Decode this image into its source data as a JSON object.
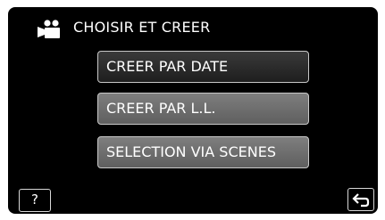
{
  "header": {
    "icon": "video-camera-icon",
    "title": "CHOISIR ET CREER"
  },
  "menu": {
    "items": [
      {
        "label": "CREER PAR DATE",
        "selected": true
      },
      {
        "label": "CREER PAR L.L.",
        "selected": false
      },
      {
        "label": "SELECTION VIA SCENES",
        "selected": false
      }
    ]
  },
  "footer": {
    "help_label": "?",
    "back_icon": "return-arrow-icon"
  },
  "colors": {
    "screen_bg": "#000000",
    "selected_button": "#2c2c2c",
    "normal_button": "#6e6e6e",
    "text": "#ffffff",
    "border": "#c8c8c8"
  }
}
